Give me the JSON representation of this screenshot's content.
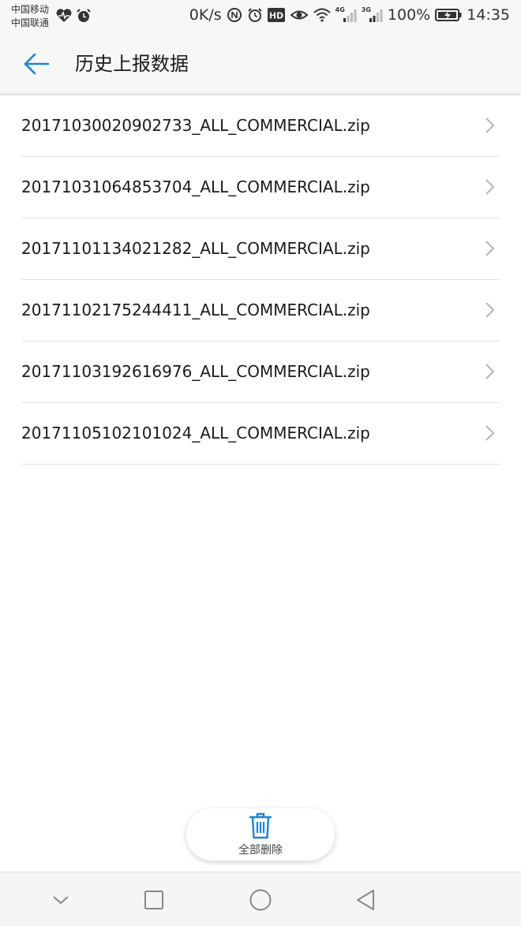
{
  "status_bar": {
    "carrier1": "中国移动",
    "carrier2": "中国联通",
    "speed": "0K/s",
    "hd_badge": "HD",
    "net_4g": "4G",
    "net_3g": "3G",
    "battery": "100%",
    "time": "14:35",
    "icons": [
      "heart-rate-icon",
      "alarm-icon",
      "nfc-icon",
      "alarm-clock-icon",
      "hd-icon",
      "eye-comfort-icon",
      "wifi-icon",
      "signal-4g-icon",
      "signal-3g-icon",
      "battery-charging-icon"
    ]
  },
  "app_bar": {
    "title": "历史上报数据",
    "back_icon": "arrow-left-icon"
  },
  "files": [
    {
      "name": "20171030020902733_ALL_COMMERCIAL.zip"
    },
    {
      "name": "20171031064853704_ALL_COMMERCIAL.zip"
    },
    {
      "name": "20171101134021282_ALL_COMMERCIAL.zip"
    },
    {
      "name": "20171102175244411_ALL_COMMERCIAL.zip"
    },
    {
      "name": "20171103192616976_ALL_COMMERCIAL.zip"
    },
    {
      "name": "20171105102101024_ALL_COMMERCIAL.zip"
    }
  ],
  "actions": {
    "delete_all_label": "全部删除",
    "delete_icon": "trash-icon"
  },
  "nav_bar": {
    "icons": [
      "chevron-down-icon",
      "square-icon",
      "circle-icon",
      "triangle-back-icon"
    ]
  },
  "colors": {
    "accent": "#1b83d8",
    "chevron": "#b5b5b5",
    "divider": "#e3e3e3"
  }
}
